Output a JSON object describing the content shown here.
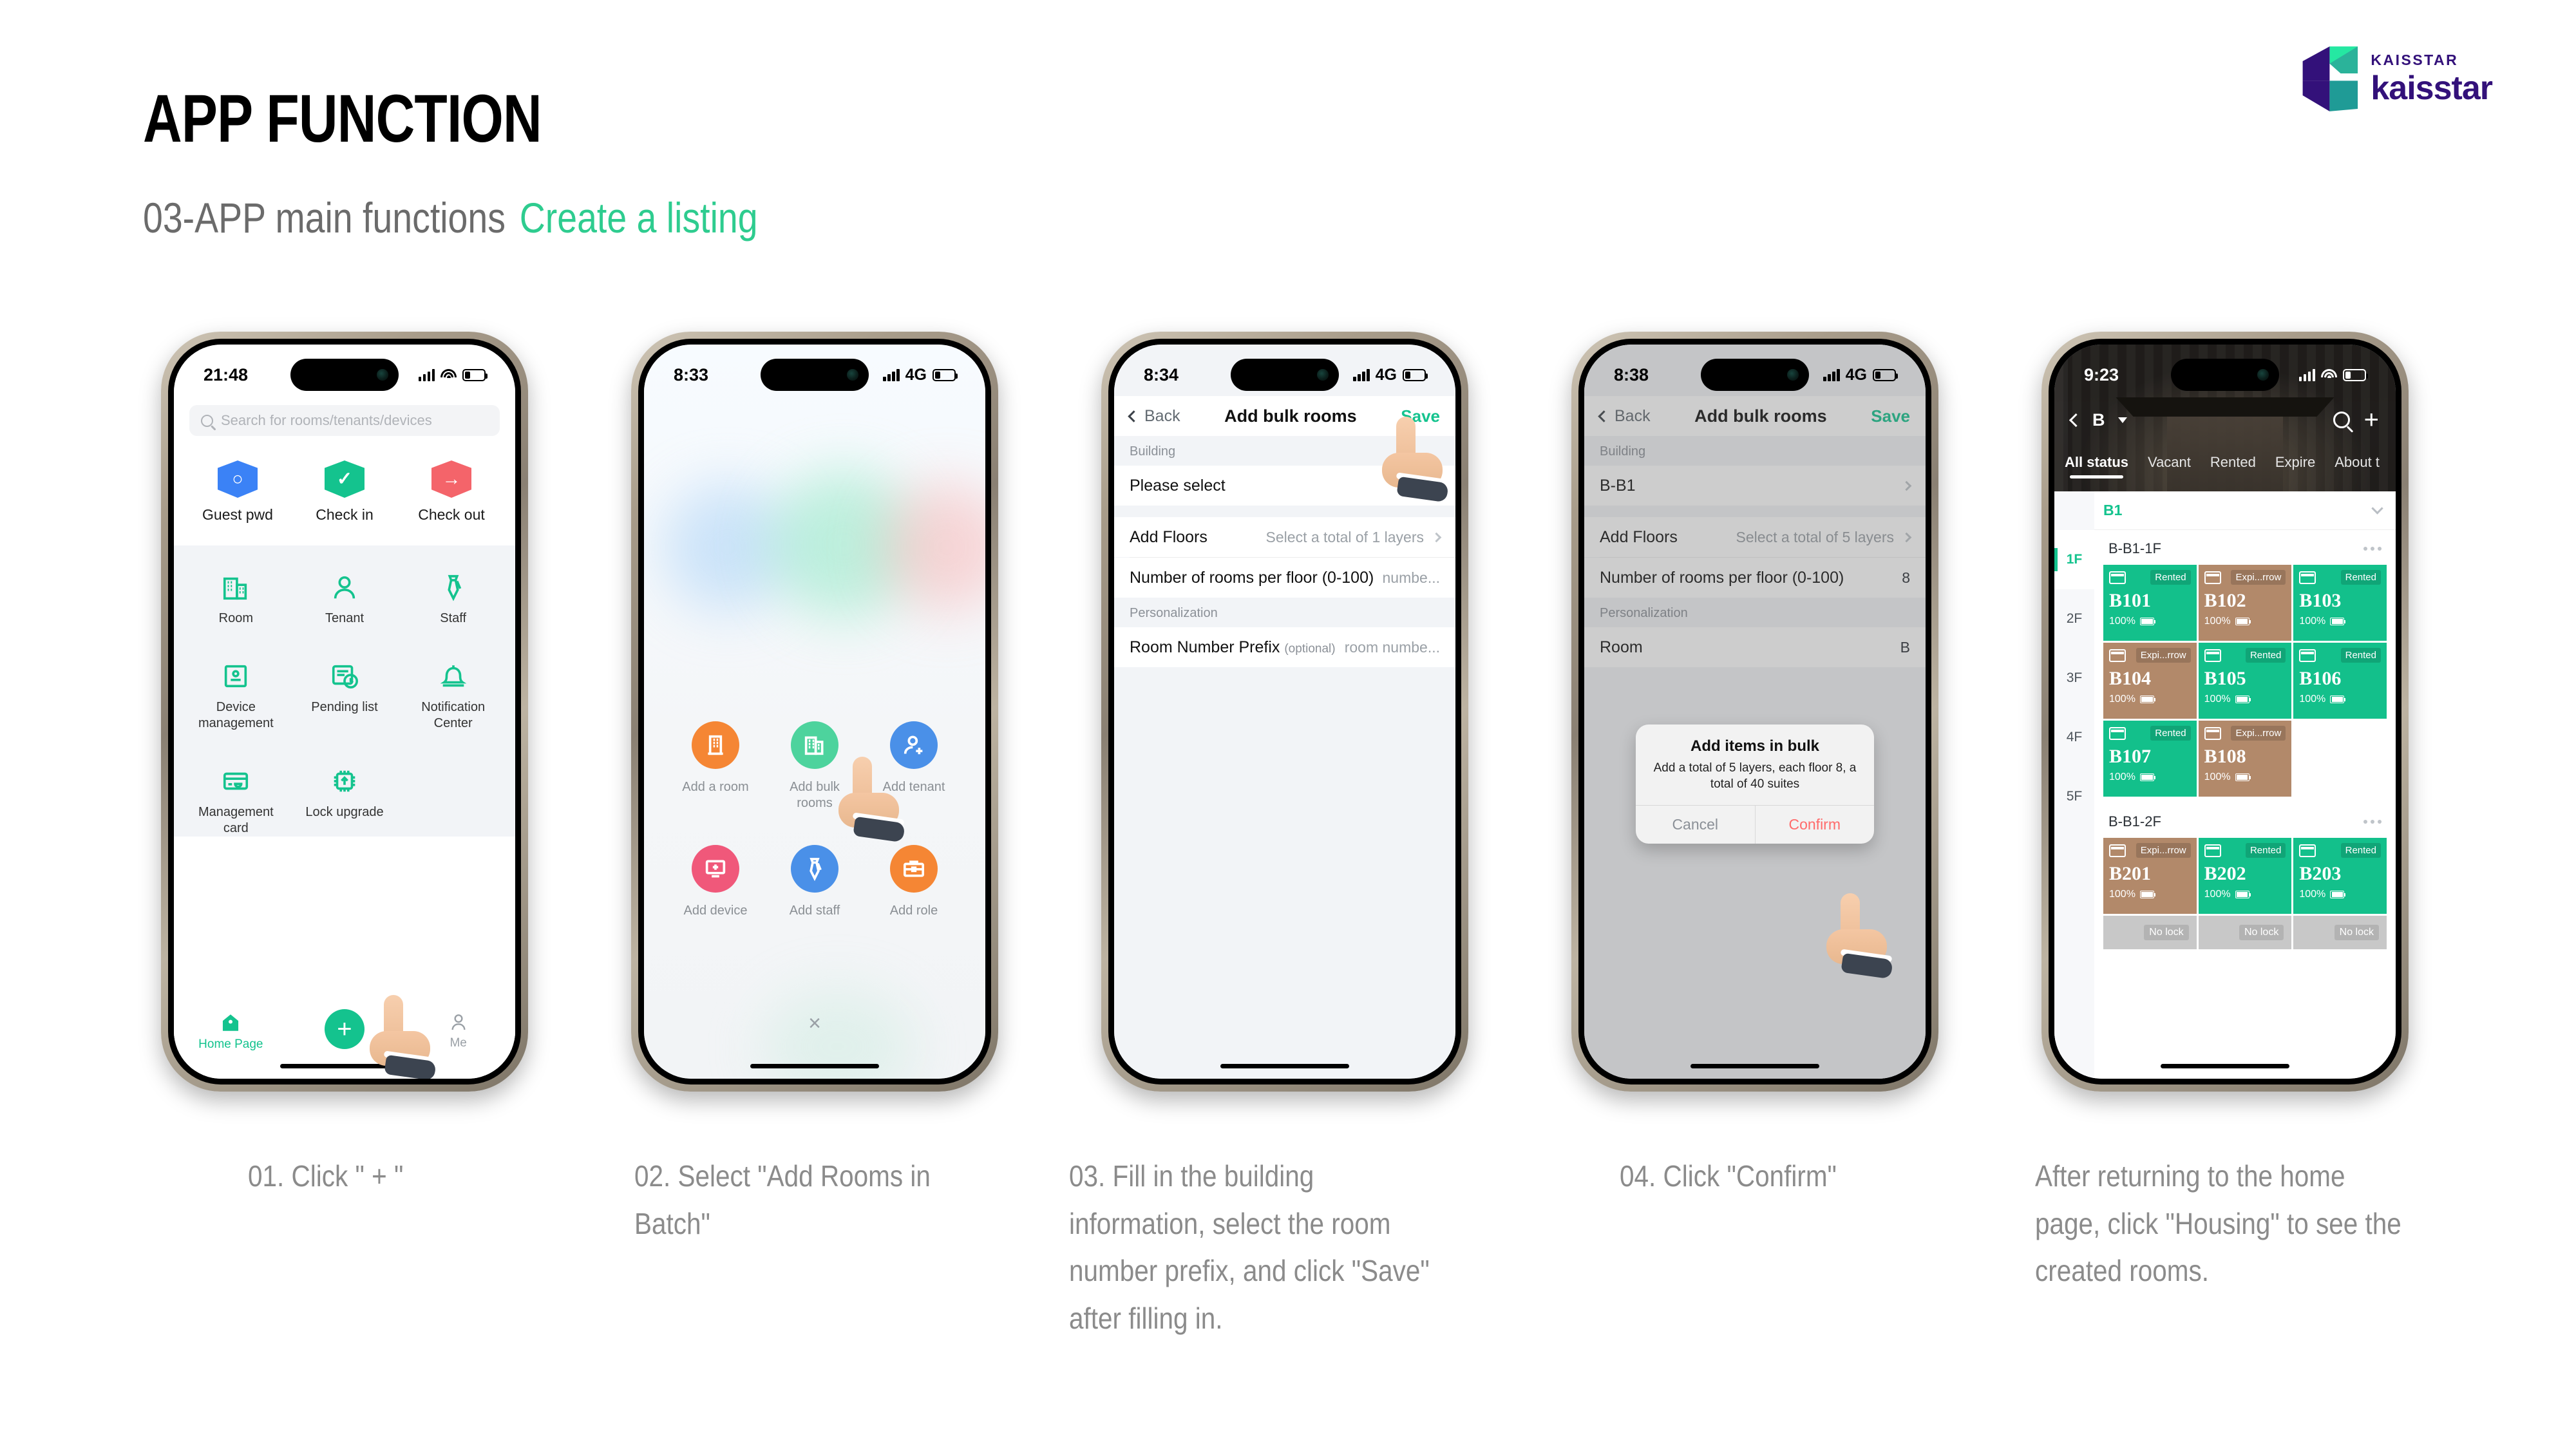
{
  "header": {
    "title": "APP FUNCTION",
    "subtitle_main": "03-APP main functions",
    "subtitle_accent": "Create a listing",
    "accent_color": "#2ecc8f"
  },
  "logo": {
    "small_text": "KAISSTAR",
    "large_text": "kaisstar",
    "color": "#33117a"
  },
  "phone1": {
    "status": {
      "time": "21:48",
      "network": "",
      "battery_pct": ""
    },
    "search_placeholder": "Search for rooms/tenants/devices",
    "quick_actions": [
      {
        "label": "Guest pwd",
        "color": "#3b82f6",
        "icon": "search-shield-icon"
      },
      {
        "label": "Check in",
        "color": "#14c38e",
        "icon": "check-shield-icon"
      },
      {
        "label": "Check out",
        "color": "#f4646a",
        "icon": "arrow-shield-icon"
      }
    ],
    "grid_items": [
      {
        "label": "Room",
        "icon": "building-icon"
      },
      {
        "label": "Tenant",
        "icon": "person-icon"
      },
      {
        "label": "Staff",
        "icon": "tie-icon"
      },
      {
        "label": "Device management",
        "icon": "device-icon"
      },
      {
        "label": "Pending list",
        "icon": "pending-list-icon"
      },
      {
        "label": "Notification Center",
        "icon": "bell-icon"
      },
      {
        "label": "Management card",
        "icon": "card-icon"
      },
      {
        "label": "Lock upgrade",
        "icon": "chip-upgrade-icon"
      }
    ],
    "tabs": [
      {
        "label": "Home Page",
        "icon": "home-icon",
        "active": true
      },
      {
        "label": "+",
        "icon": "plus-fab-icon",
        "active": false
      },
      {
        "label": "Me",
        "icon": "person-outline-icon",
        "active": false
      }
    ]
  },
  "phone2": {
    "status": {
      "time": "8:33",
      "network": "4G"
    },
    "actions": [
      {
        "label": "Add a room",
        "color": "#f58634",
        "icon": "building-add-icon"
      },
      {
        "label": "Add bulk rooms",
        "color": "#4dd39d",
        "icon": "buildings-icon"
      },
      {
        "label": "Add tenant",
        "color": "#4a90e8",
        "icon": "person-add-icon"
      },
      {
        "label": "Add device",
        "color": "#f0587a",
        "icon": "device-add-icon"
      },
      {
        "label": "Add staff",
        "color": "#4a90e8",
        "icon": "tie-icon"
      },
      {
        "label": "Add role",
        "color": "#f58634",
        "icon": "briefcase-icon"
      }
    ],
    "close_label": "×"
  },
  "phone3": {
    "status": {
      "time": "8:34",
      "network": "4G"
    },
    "nav": {
      "back": "Back",
      "title": "Add bulk rooms",
      "save": "Save"
    },
    "section_building": "Building",
    "building_value": "Please select",
    "add_floors_label": "Add Floors",
    "add_floors_value": "Select a total of 1 layers",
    "rooms_per_floor_label": "Number of rooms per floor (0-100)",
    "rooms_per_floor_value": "numbe...",
    "section_personalization": "Personalization",
    "prefix_label": "Room Number Prefix",
    "prefix_optional": "(optional)",
    "prefix_value": "room numbe..."
  },
  "phone4": {
    "status": {
      "time": "8:38",
      "network": "4G"
    },
    "nav": {
      "back": "Back",
      "title": "Add bulk rooms",
      "save": "Save"
    },
    "section_building": "Building",
    "building_value": "B-B1",
    "add_floors_label": "Add Floors",
    "add_floors_value": "Select a total of 5 layers",
    "rooms_per_floor_label": "Number of rooms per floor (0-100)",
    "rooms_per_floor_value": "8",
    "section_personalization": "Personalization",
    "prefix_label": "Room",
    "prefix_value": "B",
    "dialog": {
      "title": "Add items in bulk",
      "message": "Add a total of 5 layers, each floor 8, a total of 40 suites",
      "cancel": "Cancel",
      "confirm": "Confirm"
    }
  },
  "phone5": {
    "status": {
      "time": "9:23"
    },
    "nav": {
      "building": "B",
      "search_icon": "search-icon",
      "add_icon": "plus-icon"
    },
    "tabs": [
      {
        "label": "All status",
        "active": true
      },
      {
        "label": "Vacant",
        "active": false
      },
      {
        "label": "Rented",
        "active": false
      },
      {
        "label": "Expire",
        "active": false
      },
      {
        "label": "About t",
        "active": false
      }
    ],
    "building_group": "B1",
    "floors": [
      {
        "label": "1F",
        "active": true
      },
      {
        "label": "2F",
        "active": false
      },
      {
        "label": "3F",
        "active": false
      },
      {
        "label": "4F",
        "active": false
      },
      {
        "label": "5F",
        "active": false
      }
    ],
    "floor_sections": [
      {
        "title": "B-B1-1F",
        "rooms": [
          {
            "no": "B101",
            "status": "Rented",
            "battery": "100%",
            "type": "rented"
          },
          {
            "no": "B102",
            "status": "Expi...rrow",
            "battery": "100%",
            "type": "expiring"
          },
          {
            "no": "B103",
            "status": "Rented",
            "battery": "100%",
            "type": "rented"
          },
          {
            "no": "B104",
            "status": "Expi...rrow",
            "battery": "100%",
            "type": "expiring"
          },
          {
            "no": "B105",
            "status": "Rented",
            "battery": "100%",
            "type": "rented"
          },
          {
            "no": "B106",
            "status": "Rented",
            "battery": "100%",
            "type": "rented"
          },
          {
            "no": "B107",
            "status": "Rented",
            "battery": "100%",
            "type": "rented"
          },
          {
            "no": "B108",
            "status": "Expi...rrow",
            "battery": "100%",
            "type": "expiring"
          }
        ]
      },
      {
        "title": "B-B1-2F",
        "rooms": [
          {
            "no": "B201",
            "status": "Expi...rrow",
            "battery": "100%",
            "type": "expiring"
          },
          {
            "no": "B202",
            "status": "Rented",
            "battery": "100%",
            "type": "rented"
          },
          {
            "no": "B203",
            "status": "Rented",
            "battery": "100%",
            "type": "rented"
          }
        ]
      }
    ],
    "no_lock_label": "No lock"
  },
  "captions": [
    "01. Click \" + \"",
    "02. Select \"Add Rooms in Batch\"",
    "03. Fill in the building information, select the room number prefix, and click \"Save\" after filling in.",
    "04. Click \"Confirm\"",
    "After returning to the home page, click \"Housing\" to see the created rooms."
  ]
}
